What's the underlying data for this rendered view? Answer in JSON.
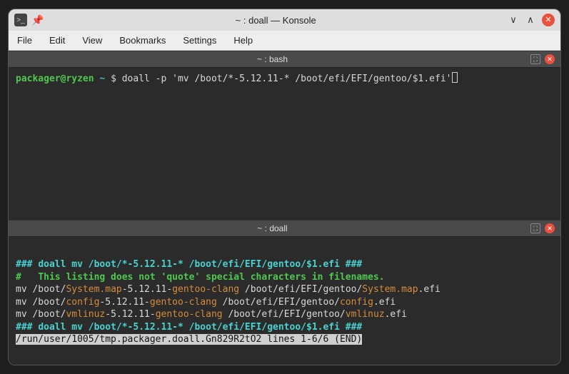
{
  "window": {
    "title": "~ : doall — Konsole"
  },
  "menubar": {
    "file": "File",
    "edit": "Edit",
    "view": "View",
    "bookmarks": "Bookmarks",
    "settings": "Settings",
    "help": "Help"
  },
  "panes": {
    "top": {
      "label": "~ : bash",
      "prompt_user": "packager@ryzen",
      "prompt_path": "~",
      "prompt_symbol": "$",
      "cmd": "doall -p 'mv /boot/*-5.12.11-* /boot/efi/EFI/gentoo/$1.efi'"
    },
    "bottom": {
      "label": "~ : doall",
      "hdr_prefix": "###",
      "hdr_cmd": "doall mv /boot/*-5.12.11-* /boot/efi/EFI/gentoo/$1.efi",
      "hdr_suffix": "###",
      "note_hash": "#",
      "note": "This listing does not 'quote' special characters in filenames.",
      "rows": [
        {
          "mv": "mv",
          "pre": "/boot/",
          "name": "System.map",
          "mid": "-5.12.11-",
          "tag": "gentoo-clang",
          "dst_pre": " /boot/efi/EFI/gentoo/",
          "dst_name": "System.map",
          "dst_ext": ".efi"
        },
        {
          "mv": "mv",
          "pre": "/boot/",
          "name": "config",
          "mid": "-5.12.11-",
          "tag": "gentoo-clang",
          "dst_pre": " /boot/efi/EFI/gentoo/",
          "dst_name": "config",
          "dst_ext": ".efi"
        },
        {
          "mv": "mv",
          "pre": "/boot/",
          "name": "vmlinuz",
          "mid": "-5.12.11-",
          "tag": "gentoo-clang",
          "dst_pre": " /boot/efi/EFI/gentoo/",
          "dst_name": "vmlinuz",
          "dst_ext": ".efi"
        }
      ],
      "footer_prefix": "###",
      "footer_cmd": "doall mv /boot/*-5.12.11-* /boot/efi/EFI/gentoo/$1.efi",
      "footer_suffix": "###",
      "pager": "/run/user/1005/tmp.packager.doall.Gn829R2tO2 lines 1-6/6 (END)"
    }
  }
}
